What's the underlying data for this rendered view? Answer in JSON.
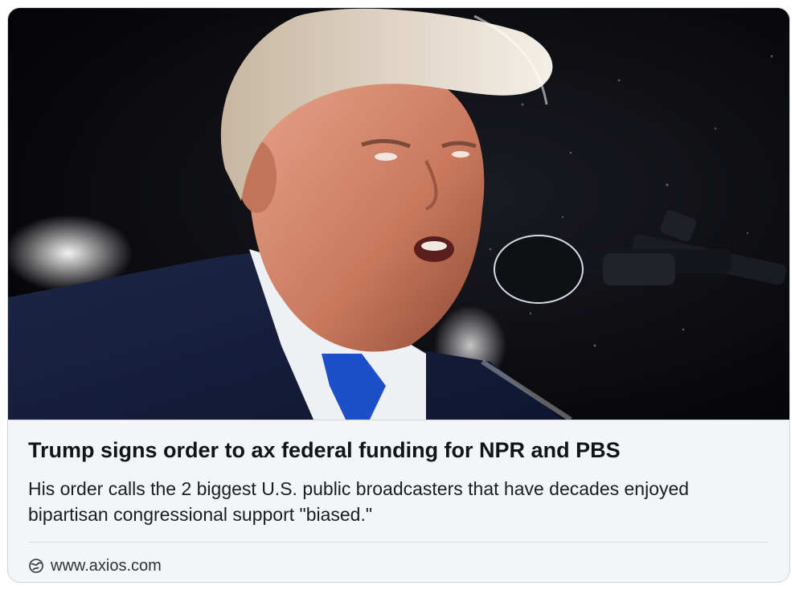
{
  "card": {
    "headline": "Trump signs order to ax federal funding for NPR and PBS",
    "description": "His order calls the 2 biggest U.S. public broadcasters that have  decades enjoyed bipartisan congressional support \"biased.\"",
    "source": "www.axios.com",
    "source_icon": "globe-icon",
    "image_icon": "photo-of-speaker-at-microphone"
  },
  "colors": {
    "background": "#f3f5f8",
    "border": "#cfd6de",
    "headline": "#131417",
    "text": "#1b1d22"
  }
}
